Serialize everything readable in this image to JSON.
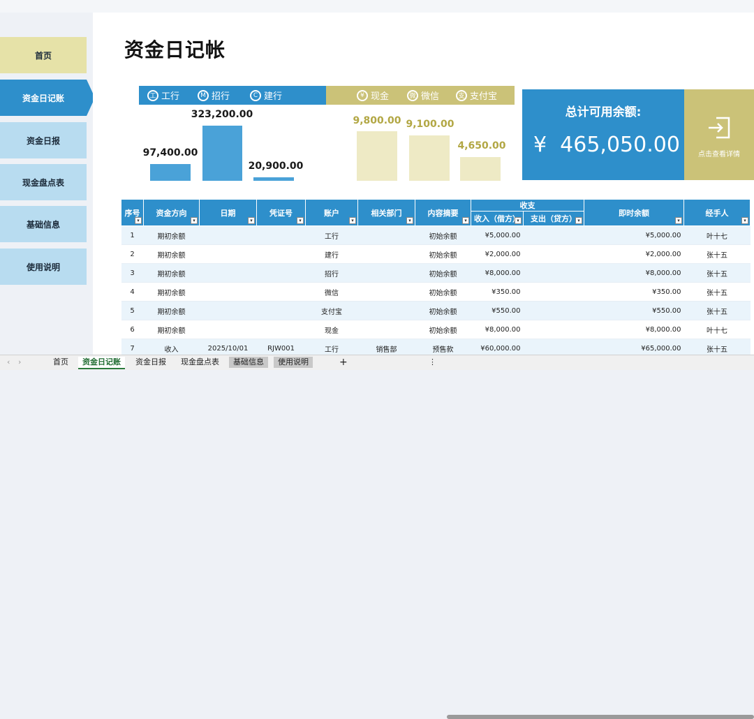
{
  "nav": [
    "首页",
    "资金日记账",
    "资金日报",
    "现金盘点表",
    "基础信息",
    "使用说明"
  ],
  "title": "资金日记帐",
  "banks": [
    {
      "label": "工行",
      "icon": "icbc-icon",
      "value": "97,400.00"
    },
    {
      "label": "招行",
      "icon": "cmb-icon",
      "value": "323,200.00"
    },
    {
      "label": "建行",
      "icon": "ccb-icon",
      "value": "20,900.00"
    }
  ],
  "others": [
    {
      "label": "现金",
      "icon": "cash-icon",
      "value": "9,800.00"
    },
    {
      "label": "微信",
      "icon": "wechat-icon",
      "value": "9,100.00"
    },
    {
      "label": "支付宝",
      "icon": "alipay-icon",
      "value": "4,650.00"
    }
  ],
  "total": {
    "title": "总计可用余额:",
    "currency": "¥",
    "value": "465,050.00",
    "detail": "点击查看详情"
  },
  "table": {
    "headers": [
      "序号",
      "资金方向",
      "日期",
      "凭证号",
      "账户",
      "相关部门",
      "内容摘要",
      "收支",
      "收入（借方）",
      "支出（贷方）",
      "即时余额",
      "经手人"
    ],
    "rows": [
      [
        "1",
        "期初余额",
        "",
        "",
        "工行",
        "",
        "初始余额",
        "¥5,000.00",
        "",
        "¥5,000.00",
        "叶十七"
      ],
      [
        "2",
        "期初余额",
        "",
        "",
        "建行",
        "",
        "初始余额",
        "¥2,000.00",
        "",
        "¥2,000.00",
        "张十五"
      ],
      [
        "3",
        "期初余额",
        "",
        "",
        "招行",
        "",
        "初始余额",
        "¥8,000.00",
        "",
        "¥8,000.00",
        "张十五"
      ],
      [
        "4",
        "期初余额",
        "",
        "",
        "微信",
        "",
        "初始余额",
        "¥350.00",
        "",
        "¥350.00",
        "张十五"
      ],
      [
        "5",
        "期初余额",
        "",
        "",
        "支付宝",
        "",
        "初始余额",
        "¥550.00",
        "",
        "¥550.00",
        "张十五"
      ],
      [
        "6",
        "期初余额",
        "",
        "",
        "现金",
        "",
        "初始余额",
        "¥8,000.00",
        "",
        "¥8,000.00",
        "叶十七"
      ],
      [
        "7",
        "收入",
        "2025/10/01",
        "RJW001",
        "工行",
        "销售部",
        "预售款",
        "¥60,000.00",
        "",
        "¥65,000.00",
        "张十五"
      ]
    ]
  },
  "tabs": [
    "首页",
    "资金日记账",
    "资金日报",
    "现金盘点表",
    "基础信息",
    "使用说明",
    "+"
  ],
  "colors": {
    "blue": "#2e8fcb",
    "yellow": "#cbc278"
  }
}
